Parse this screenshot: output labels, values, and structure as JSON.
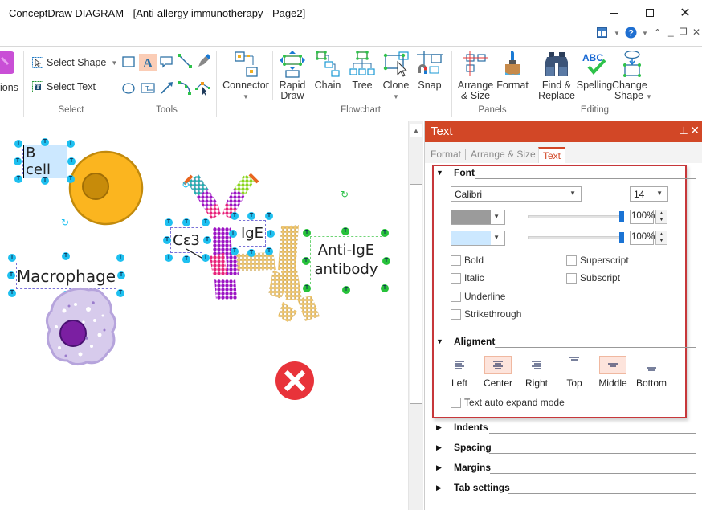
{
  "window": {
    "title": "ConceptDraw DIAGRAM - [Anti-allergy immunotherapy - Page2]",
    "controls": {
      "minimize": "—",
      "maximize": "☐",
      "close": "✕"
    },
    "sub_controls": {
      "layout": "▥",
      "help": "?",
      "collapse": "⌂",
      "min": "_",
      "restore": "🗗",
      "close": "✕"
    }
  },
  "ribbon": {
    "partial_left_label": "ions",
    "select": {
      "label": "Select",
      "select_shape": "Select Shape",
      "select_text": "Select Text"
    },
    "tools": {
      "label": "Tools"
    },
    "flowchart": {
      "label": "Flowchart",
      "items": [
        {
          "name": "connector",
          "label": "Connector",
          "has_dropdown": true
        },
        {
          "name": "rapid-draw",
          "label": "Rapid Draw"
        },
        {
          "name": "chain",
          "label": "Chain"
        },
        {
          "name": "tree",
          "label": "Tree"
        },
        {
          "name": "clone",
          "label": "Clone",
          "has_dropdown": true
        },
        {
          "name": "snap",
          "label": "Snap"
        }
      ]
    },
    "panels": {
      "label": "Panels",
      "items": [
        {
          "name": "arrange-size",
          "label": "Arrange & Size"
        },
        {
          "name": "format",
          "label": "Format"
        }
      ]
    },
    "editing": {
      "label": "Editing",
      "items": [
        {
          "name": "find-replace",
          "label": "Find & Replace"
        },
        {
          "name": "spelling",
          "label": "Spelling"
        },
        {
          "name": "change-shape",
          "label": "Change Shape",
          "has_dropdown": true
        }
      ]
    }
  },
  "canvas": {
    "labels": {
      "b_cell": "B cell",
      "macrophage": "Macrophage",
      "ce3": "Cε3",
      "ige": "IgE",
      "anti_ige_line1": "Anti-IgE",
      "anti_ige_line2": "antibody"
    },
    "handle_glyph": "T",
    "colors": {
      "b_cell_fill": "#fbb51f",
      "b_cell_nucleus": "#c78b0a",
      "macrophage": "#d7cbec",
      "macrophage_nucleus": "#7b1fa2",
      "delete": "#e8333a"
    }
  },
  "panel": {
    "title": "Text",
    "pin": "⊥",
    "close": "✕",
    "tabs": [
      "Format",
      "Arrange & Size",
      "Text"
    ],
    "active_tab": "Text",
    "font": {
      "heading": "Font",
      "family": "Calibri",
      "size": "14",
      "text_color": "#9b9b9b",
      "text_opacity": "100%",
      "bg_color": "#cce8ff",
      "bg_opacity": "100%",
      "opacity_fraction": 1.0,
      "checkboxes": [
        {
          "label": "Bold",
          "checked": false
        },
        {
          "label": "Italic",
          "checked": false
        },
        {
          "label": "Underline",
          "checked": false
        },
        {
          "label": "Strikethrough",
          "checked": false
        },
        {
          "label": "Superscript",
          "checked": false
        },
        {
          "label": "Subscript",
          "checked": false
        }
      ]
    },
    "alignment": {
      "heading": "Aligment",
      "buttons": [
        {
          "label": "Left",
          "active": false
        },
        {
          "label": "Center",
          "active": true
        },
        {
          "label": "Right",
          "active": false
        },
        {
          "label": "Top",
          "active": false
        },
        {
          "label": "Middle",
          "active": true
        },
        {
          "label": "Bottom",
          "active": false
        }
      ],
      "auto_expand": {
        "label": "Text auto expand mode",
        "checked": false
      }
    },
    "collapsed_sections": [
      "Indents",
      "Spacing",
      "Margins",
      "Tab settings"
    ]
  }
}
